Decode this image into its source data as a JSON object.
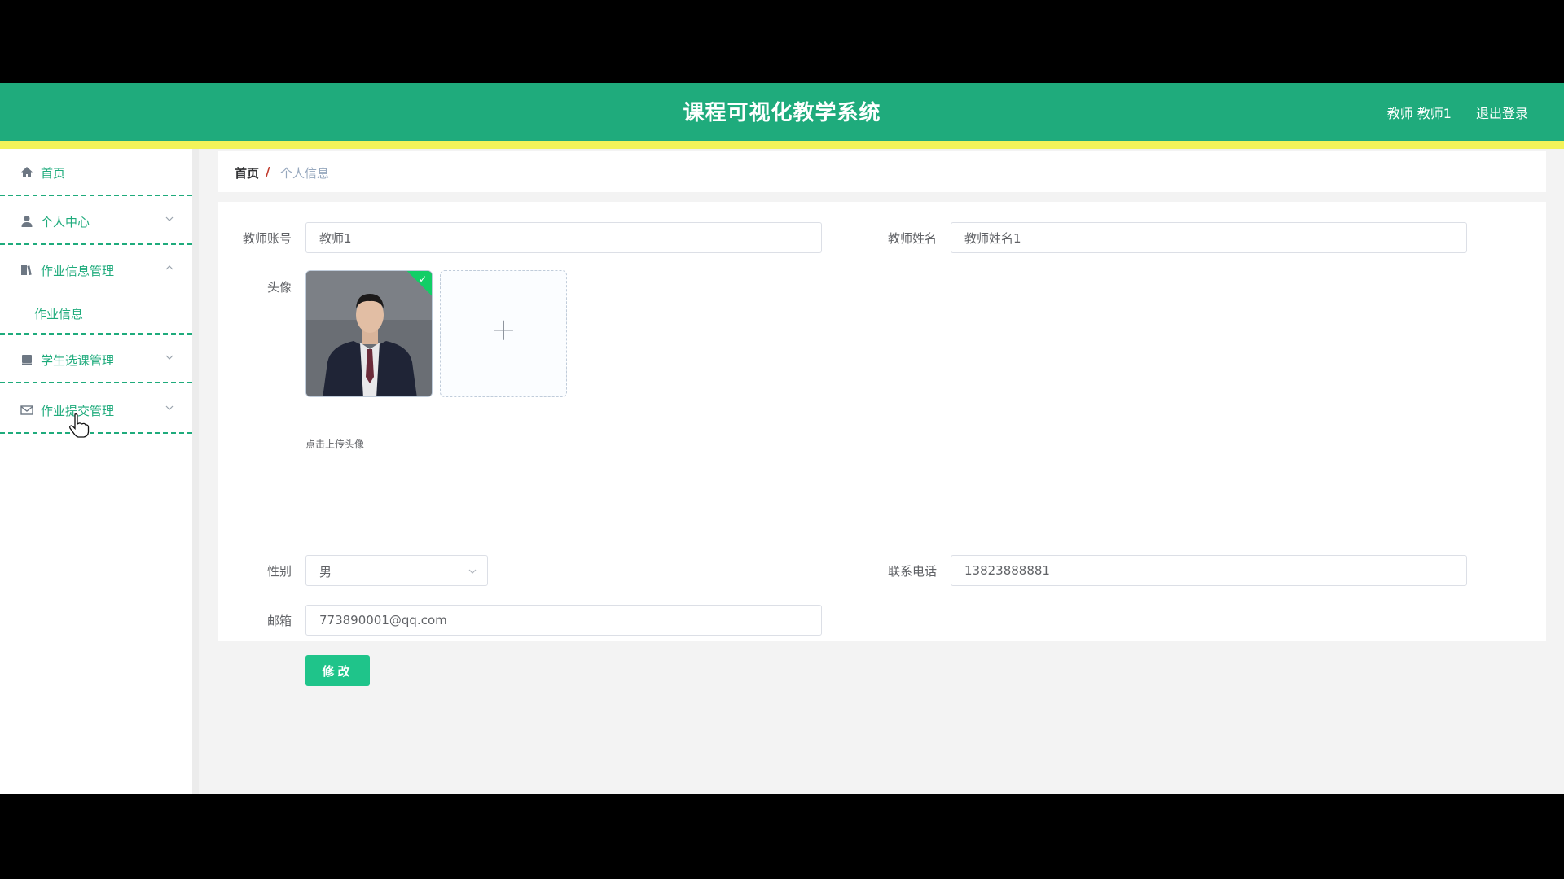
{
  "header": {
    "title": "课程可视化教学系统",
    "user": "教师 教师1",
    "logout": "退出登录",
    "bg_color": "#1fab7c",
    "accent_color": "#f3f35a"
  },
  "sidebar": {
    "items": [
      {
        "label": "首页",
        "icon": "home-icon"
      },
      {
        "label": "个人中心",
        "icon": "user-icon"
      },
      {
        "label": "作业信息管理",
        "icon": "library-icon",
        "expanded": true,
        "children": [
          {
            "label": "作业信息"
          }
        ]
      },
      {
        "label": "学生选课管理",
        "icon": "book-icon"
      },
      {
        "label": "作业提交管理",
        "icon": "mail-icon"
      }
    ]
  },
  "breadcrumb": {
    "home": "首页",
    "separator": "/",
    "current": "个人信息"
  },
  "form": {
    "account_label": "教师账号",
    "account_value": "教师1",
    "name_label": "教师姓名",
    "name_value": "教师姓名1",
    "avatar_label": "头像",
    "avatar_hint": "点击上传头像",
    "gender_label": "性别",
    "gender_value": "男",
    "phone_label": "联系电话",
    "phone_value": "13823888881",
    "email_label": "邮箱",
    "email_value": "773890001@qq.com",
    "submit_label": "修改"
  }
}
